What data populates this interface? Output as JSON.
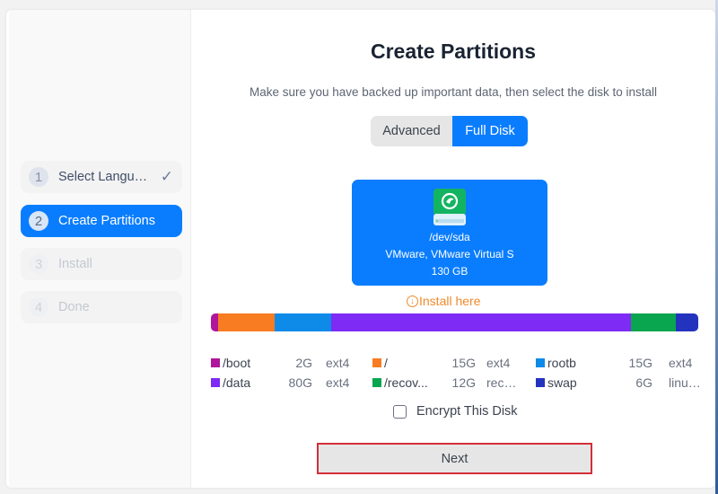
{
  "sidebar": {
    "steps": [
      {
        "number": "1",
        "label": "Select Langu…",
        "state": "done",
        "check": "✓"
      },
      {
        "number": "2",
        "label": "Create Partitions",
        "state": "active"
      },
      {
        "number": "3",
        "label": "Install",
        "state": "disabled"
      },
      {
        "number": "4",
        "label": "Done",
        "state": "disabled"
      }
    ]
  },
  "main": {
    "title": "Create Partitions",
    "subtitle": "Make sure you have backed up important data, then select the disk to install",
    "mode_tabs": [
      {
        "label": "Advanced",
        "selected": false
      },
      {
        "label": "Full Disk",
        "selected": true
      }
    ],
    "disk": {
      "icon": "hard-drive-icon",
      "name": "/dev/sda",
      "model": "VMware, VMware Virtual S",
      "size": "130 GB"
    },
    "install_here": {
      "icon": "download-circle-icon",
      "label": "Install here"
    },
    "partitions": [
      {
        "name": "/boot",
        "size": "2G",
        "size_gb": 2,
        "fs": "ext4",
        "color": "#b0159b"
      },
      {
        "name": "/",
        "size": "15G",
        "size_gb": 15,
        "fs": "ext4",
        "color": "#f87c22"
      },
      {
        "name": "rootb",
        "size": "15G",
        "size_gb": 15,
        "fs": "ext4",
        "color": "#0e8ae8"
      },
      {
        "name": "/data",
        "size": "80G",
        "size_gb": 80,
        "fs": "ext4",
        "color": "#7e2bf5"
      },
      {
        "name": "/recov...",
        "size": "12G",
        "size_gb": 12,
        "fs": "rec…",
        "color": "#0aa54f"
      },
      {
        "name": "swap",
        "size": "6G",
        "size_gb": 6,
        "fs": "linu…",
        "color": "#2433be"
      }
    ],
    "encrypt": {
      "label": "Encrypt This Disk",
      "checked": false
    },
    "next_label": "Next"
  }
}
